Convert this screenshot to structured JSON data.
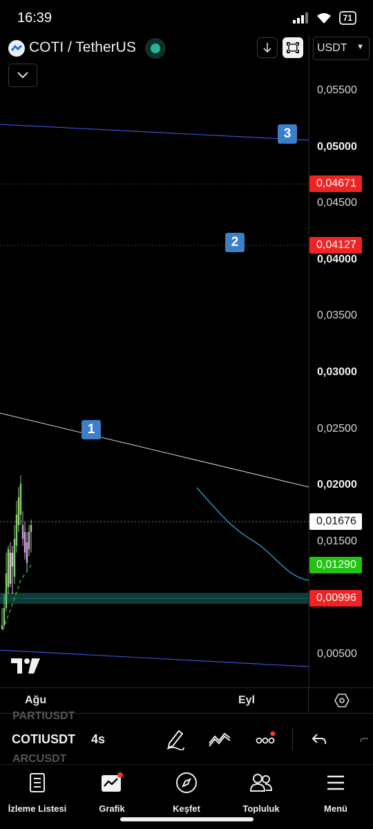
{
  "status_bar": {
    "time": "16:39",
    "battery": "71"
  },
  "header": {
    "symbol_title": "COTI / TetherUS",
    "currency": "USDT",
    "icons": [
      "coti-logo-icon",
      "market-open-icon",
      "download-icon",
      "fullscreen-icon",
      "chevron-down-icon"
    ]
  },
  "price_axis": {
    "labels": [
      {
        "text": "0,05500",
        "bold": false
      },
      {
        "text": "0,05000",
        "bold": true
      },
      {
        "text": "0,04500",
        "bold": false
      },
      {
        "text": "0,04000",
        "bold": true
      },
      {
        "text": "0,03500",
        "bold": false
      },
      {
        "text": "0,03000",
        "bold": true
      },
      {
        "text": "0,02500",
        "bold": false
      },
      {
        "text": "0,02000",
        "bold": true
      },
      {
        "text": "0,01500",
        "bold": false
      },
      {
        "text": "0,00500",
        "bold": false
      }
    ],
    "tags": [
      {
        "text": "0,04671",
        "color": "#f02323"
      },
      {
        "text": "0,04127",
        "color": "#f02323"
      },
      {
        "text": "0,01676",
        "color": "#ffffff"
      },
      {
        "text": "0,01290",
        "color": "#22c414"
      },
      {
        "text": "0,00996",
        "color": "#f02323"
      }
    ]
  },
  "chart_data": {
    "type": "candlestick",
    "symbol": "COTIUSDT",
    "interval": "4s",
    "ylim": [
      0.0038,
      0.0575
    ],
    "last_price": 0.01676,
    "horizontal_levels": [
      {
        "price": 0.04671,
        "color": "#f02323"
      },
      {
        "price": 0.04127,
        "color": "#f02323"
      },
      {
        "price": 0.01676,
        "color": "#ffffff"
      },
      {
        "price": 0.00996,
        "color": "#26a69a",
        "zone": true
      }
    ],
    "markers": [
      "1",
      "2",
      "3"
    ],
    "x_labels": [
      "Ağu",
      "Eyl"
    ]
  },
  "time_axis": {
    "labels": [
      "Ağu",
      "Eyl"
    ]
  },
  "toolbar": {
    "prev_symbol": "PARTIUSDT",
    "symbol": "COTIUSDT",
    "next_symbol": "ARCUSDT",
    "interval": "4s",
    "icons": [
      "draw-pen-icon",
      "indicators-icon",
      "more-icon",
      "undo-icon",
      "redo-icon"
    ]
  },
  "bottom_nav": {
    "items": [
      {
        "label": "İzleme Listesi",
        "icon": "watchlist-icon"
      },
      {
        "label": "Grafik",
        "icon": "chart-icon"
      },
      {
        "label": "Keşfet",
        "icon": "compass-icon"
      },
      {
        "label": "Topluluk",
        "icon": "community-icon"
      },
      {
        "label": "Menü",
        "icon": "menu-icon"
      }
    ]
  }
}
